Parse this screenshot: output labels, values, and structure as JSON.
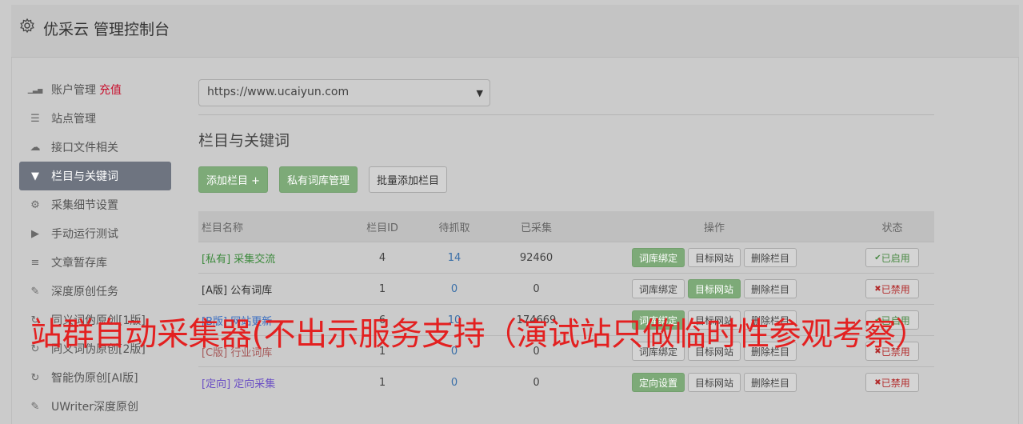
{
  "header": {
    "title": "优采云 管理控制台"
  },
  "sidebar": {
    "items": [
      {
        "label": "账户管理",
        "extra": "充值",
        "icon": "bar-chart-icon"
      },
      {
        "label": "站点管理",
        "icon": "server-icon"
      },
      {
        "label": "接口文件相关",
        "icon": "cloud-upload-icon"
      },
      {
        "label": "栏目与关键词",
        "icon": "filter-icon",
        "active": true
      },
      {
        "label": "采集细节设置",
        "icon": "gears-icon"
      },
      {
        "label": "手动运行测试",
        "icon": "play-circle-icon"
      },
      {
        "label": "文章暂存库",
        "icon": "database-icon"
      },
      {
        "label": "深度原创任务",
        "icon": "edit-icon"
      },
      {
        "label": "同义词伪原创[1版]",
        "icon": "sync-icon"
      },
      {
        "label": "同义词伪原创[2版]",
        "icon": "sync-icon"
      },
      {
        "label": "智能伪原创[AI版]",
        "icon": "sync-icon"
      },
      {
        "label": "UWriter深度原创",
        "icon": "edit-icon"
      }
    ]
  },
  "main": {
    "site_select": "https://www.ucaiyun.com",
    "section_title": "栏目与关键词",
    "buttons": {
      "add": "添加栏目 +",
      "private_lib": "私有词库管理",
      "batch_add": "批量添加栏目"
    },
    "columns": {
      "name": "栏目名称",
      "id": "栏目ID",
      "wait": "待抓取",
      "done": "已采集",
      "ops": "操作",
      "status": "状态"
    },
    "rows": [
      {
        "tag": "[私有]",
        "name": "采集交流",
        "tag_color": "green",
        "id": "4",
        "wait": "14",
        "done": "92460",
        "op1": "词库绑定",
        "op1_green": true,
        "op2": "目标网站",
        "op2_green": false,
        "op3": "删除栏目",
        "status": "已启用",
        "status_on": true
      },
      {
        "tag": "[A版]",
        "name": "公有词库",
        "tag_color": "gray",
        "id": "1",
        "wait": "0",
        "done": "0",
        "op1": "词库绑定",
        "op1_green": false,
        "op2": "目标网站",
        "op2_green": true,
        "op3": "删除栏目",
        "status": "已禁用",
        "status_on": false
      },
      {
        "tag": "[B版]",
        "name": "网站更新",
        "tag_color": "blue",
        "id": "6",
        "wait": "10",
        "done": "174669",
        "op1": "词库绑定",
        "op1_green": true,
        "op2": "目标网站",
        "op2_green": false,
        "op3": "删除栏目",
        "status": "已启用",
        "status_on": true
      },
      {
        "tag": "[C版]",
        "name": "行业词库",
        "tag_color": "red",
        "id": "1",
        "wait": "0",
        "done": "0",
        "op1": "词库绑定",
        "op1_green": false,
        "op2": "目标网站",
        "op2_green": false,
        "op3": "删除栏目",
        "status": "已禁用",
        "status_on": false
      },
      {
        "tag": "[定向]",
        "name": "定向采集",
        "tag_color": "purple",
        "id": "1",
        "wait": "0",
        "done": "0",
        "op1": "定向设置",
        "op1_green": true,
        "op2": "目标网站",
        "op2_green": false,
        "op3": "删除栏目",
        "status": "已禁用",
        "status_on": false
      }
    ]
  },
  "overlay_text": "站群自动采集器(不出示服务支持（演试站只做临时性参观考察）"
}
